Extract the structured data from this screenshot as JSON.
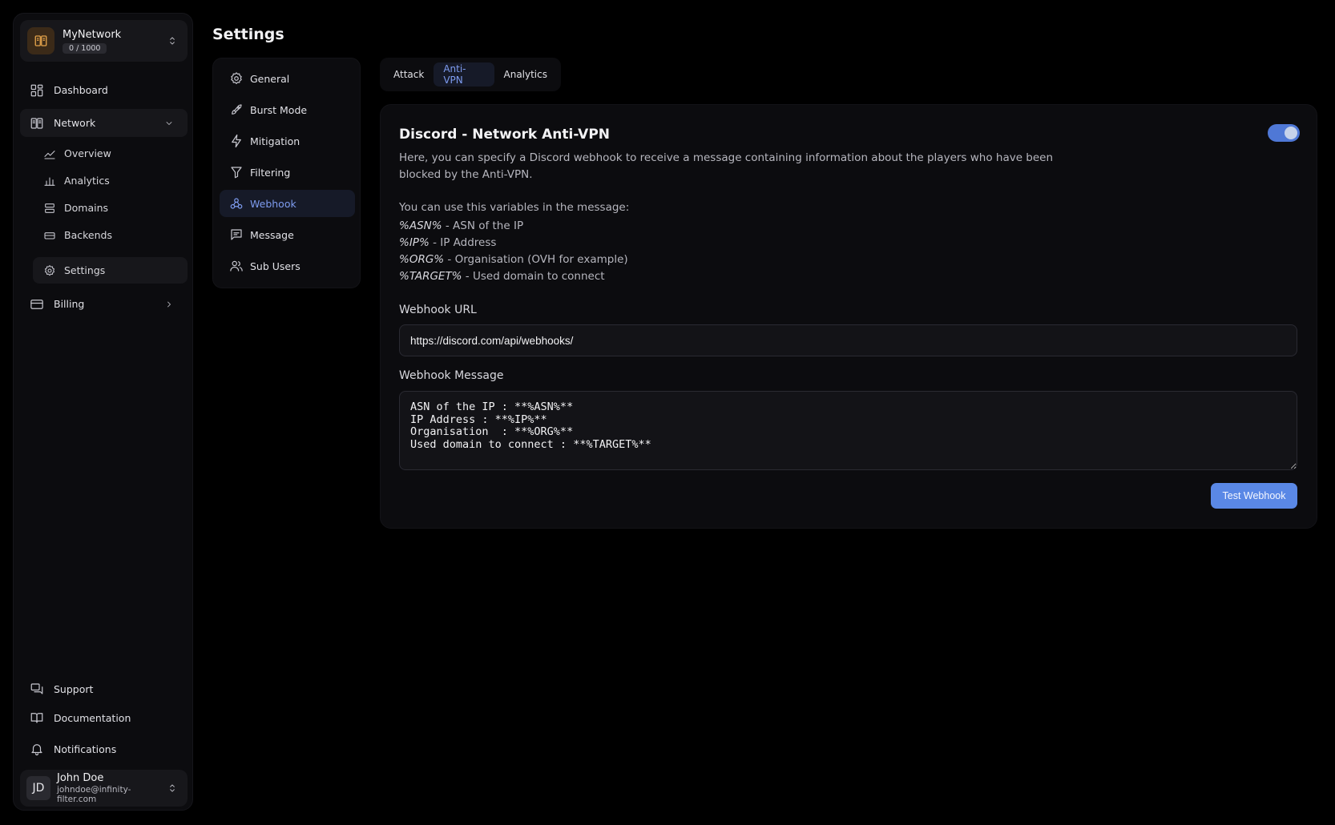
{
  "page": {
    "title": "Settings"
  },
  "org": {
    "name": "MyNetwork",
    "quota": "0 / 1000"
  },
  "sidebar": {
    "dashboard": "Dashboard",
    "network": "Network",
    "network_items": [
      "Overview",
      "Analytics",
      "Domains",
      "Backends",
      "Settings"
    ],
    "billing": "Billing",
    "support": "Support",
    "documentation": "Documentation",
    "notifications": "Notifications"
  },
  "user": {
    "initials": "JD",
    "name": "John Doe",
    "email": "johndoe@infinity-filter.com"
  },
  "settings_menu": [
    "General",
    "Burst Mode",
    "Mitigation",
    "Filtering",
    "Webhook",
    "Message",
    "Sub Users"
  ],
  "settings_menu_active": "Webhook",
  "tabs": [
    "Attack",
    "Anti-VPN",
    "Analytics"
  ],
  "tab_active": "Anti-VPN",
  "card": {
    "title": "Discord - Network Anti-VPN",
    "enabled": true,
    "description": "Here, you can specify a Discord webhook to receive a message containing information about the players who have been blocked by the Anti-VPN.",
    "vars_intro": "You can use this variables in the message:",
    "variables": [
      {
        "name": "%ASN%",
        "desc": " - ASN of the IP"
      },
      {
        "name": "%IP%",
        "desc": " - IP Address"
      },
      {
        "name": "%ORG%",
        "desc": " - Organisation (OVH for example)"
      },
      {
        "name": "%TARGET%",
        "desc": " - Used domain to connect"
      }
    ],
    "url_label": "Webhook URL",
    "url_value": "https://discord.com/api/webhooks/",
    "message_label": "Webhook Message",
    "message_value": "ASN of the IP : **%ASN%**\nIP Address : **%IP%**\nOrganisation  : **%ORG%**\nUsed domain to connect : **%TARGET%**",
    "test_button": "Test Webhook"
  },
  "colors": {
    "accent": "#5a88e6",
    "active_text": "#7e9cf0",
    "background": "#000000",
    "panel": "#0c0c0f"
  }
}
